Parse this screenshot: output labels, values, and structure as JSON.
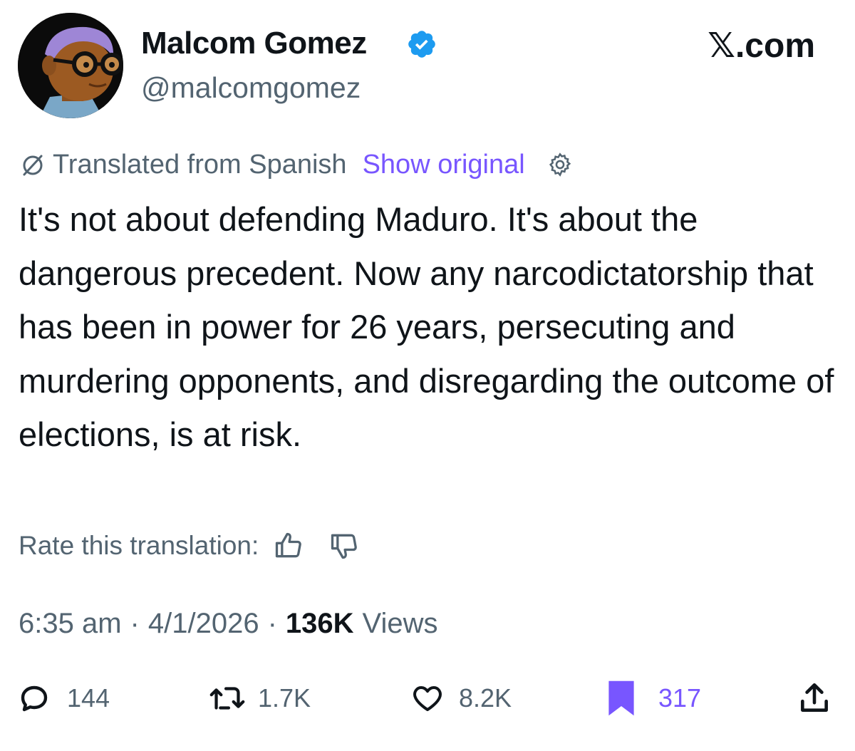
{
  "author": {
    "name": "Malcom Gomez",
    "handle": "@malcomgomez",
    "verified": true,
    "avatar_icon": "cartoon-avatar-with-glasses"
  },
  "brand": "𝕏.com",
  "translation": {
    "note": "Translated from Spanish",
    "show_original_label": "Show original",
    "rate_label": "Rate this translation:"
  },
  "tweet": {
    "text": "It's not about defending Maduro. It's about the dangerous precedent. Now any narcodictatorship that has been in power for 26 years, persecuting and murdering opponents, and disregarding the outcome of elections, is at risk."
  },
  "meta": {
    "time": "6:35 am",
    "separator": "·",
    "date": "4/1/2026",
    "views_count": "136K",
    "views_label": "Views"
  },
  "actions": {
    "replies": "144",
    "reposts": "1.7K",
    "likes": "8.2K",
    "bookmarks": "317"
  },
  "icons": [
    "verified-badge-icon",
    "translate-icon",
    "gear-icon",
    "thumbs-up-icon",
    "thumbs-down-icon",
    "reply-icon",
    "repost-icon",
    "like-icon",
    "bookmark-icon",
    "share-icon"
  ],
  "colors": {
    "text": "#0f1419",
    "muted": "#536471",
    "accent": "#7856ff",
    "verified": "#1d9bf0"
  }
}
